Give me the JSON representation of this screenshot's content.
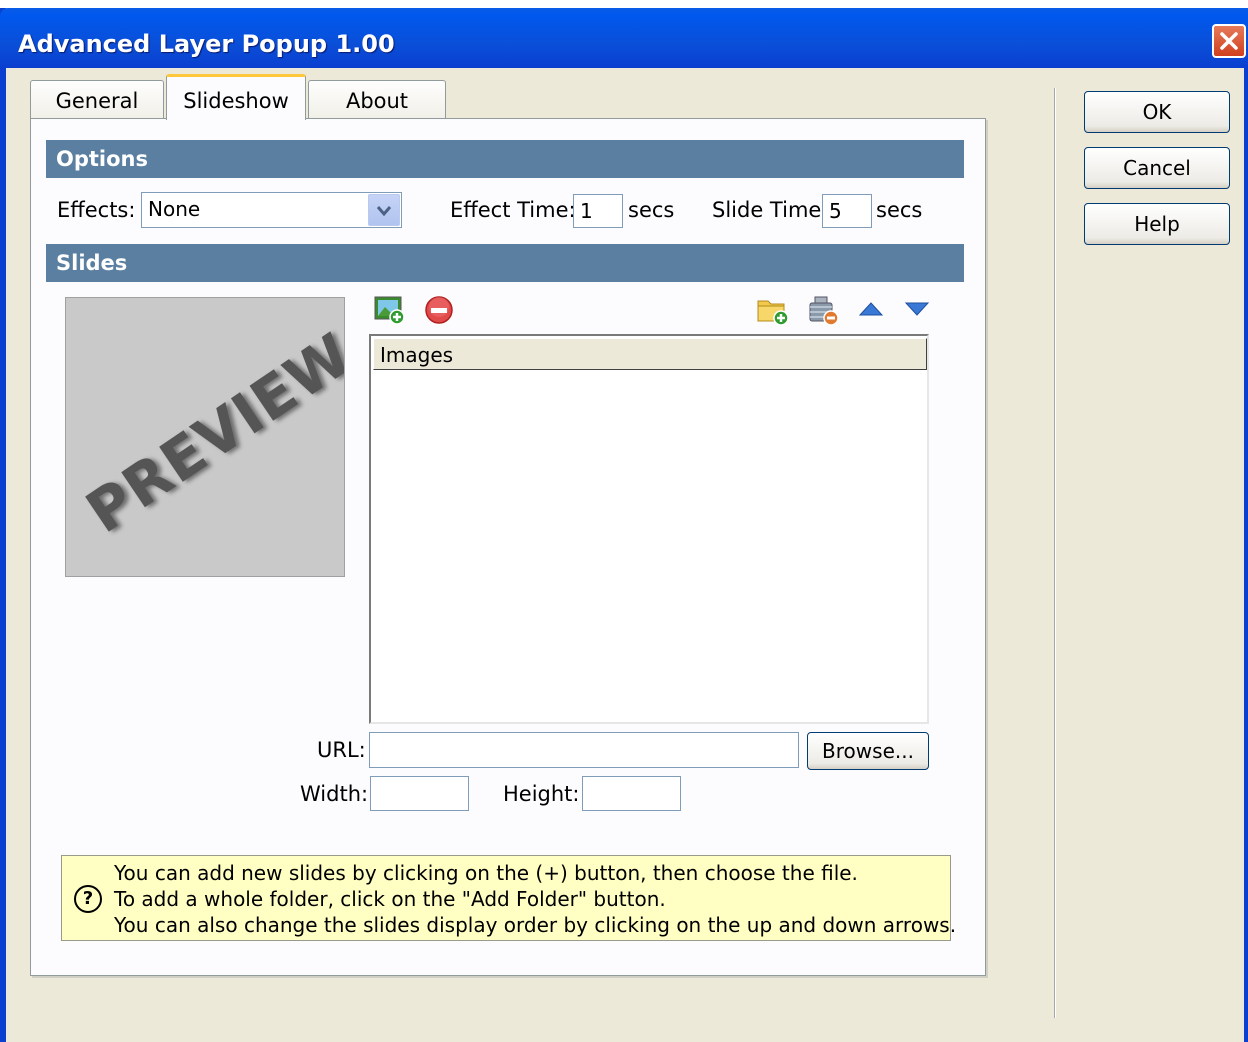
{
  "window": {
    "title": "Advanced Layer Popup 1.00",
    "close_icon": "close-icon"
  },
  "tabs": [
    {
      "label": "General",
      "active": false
    },
    {
      "label": "Slideshow",
      "active": true
    },
    {
      "label": "About",
      "active": false
    }
  ],
  "options": {
    "header": "Options",
    "effects_label": "Effects:",
    "effects_value": "None",
    "effect_time_label": "Effect Time:",
    "effect_time_value": "1",
    "effect_time_unit": "secs",
    "slide_time_label": "Slide Time:",
    "slide_time_value": "5",
    "slide_time_unit": "secs"
  },
  "slides": {
    "header": "Slides",
    "preview_text": "PREVIEW",
    "list_header": "Images",
    "url_label": "URL:",
    "url_value": "",
    "browse_label": "Browse...",
    "width_label": "Width:",
    "width_value": "",
    "height_label": "Height:",
    "height_value": ""
  },
  "toolbar_icons": {
    "add": "add-image-icon",
    "remove": "remove-icon",
    "add_folder": "add-folder-icon",
    "clear": "clear-list-icon",
    "up": "move-up-icon",
    "down": "move-down-icon"
  },
  "info": {
    "icon": "help-icon",
    "glyph": "?",
    "line1": "You can add new slides by clicking on the (+) button, then choose the file.",
    "line2": "To add a whole folder, click on the \"Add Folder\" button.",
    "line3": "You can also change the slides display order by clicking on the up and down arrows."
  },
  "buttons": {
    "ok": "OK",
    "cancel": "Cancel",
    "help": "Help"
  },
  "colors": {
    "title_bar": "#0a4fd8",
    "section_header": "#5a7fa0",
    "dialog_bg": "#ece9d8",
    "info_bg": "#ffffc4",
    "active_tab_accent": "#ffc83c"
  }
}
